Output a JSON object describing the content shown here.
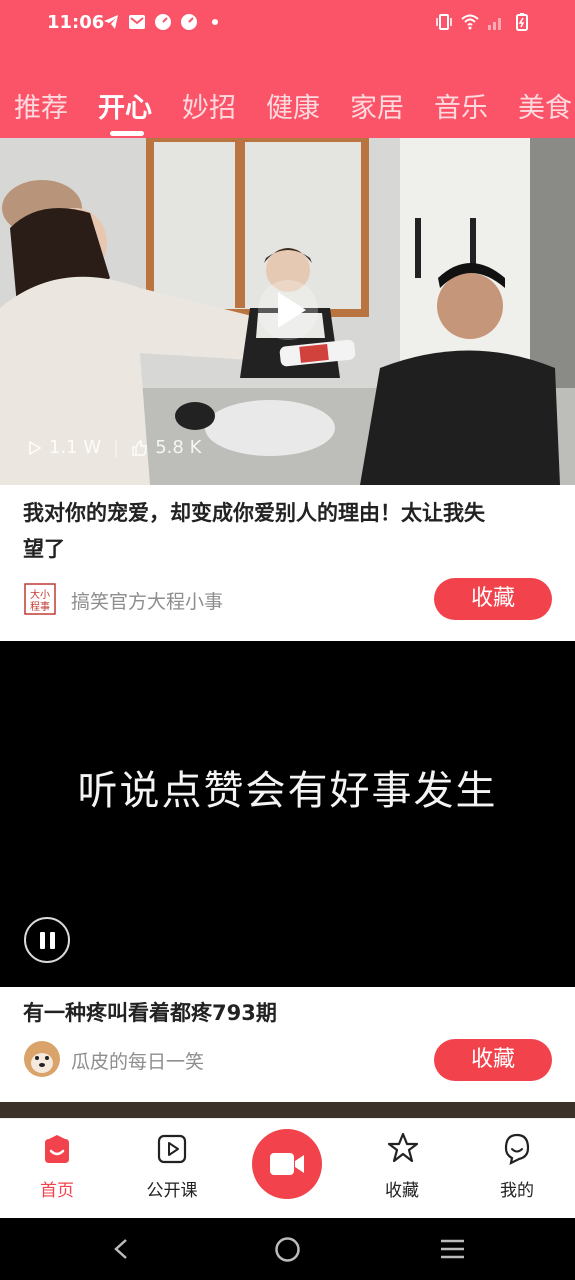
{
  "status_bar": {
    "time": "11:06"
  },
  "tabs": [
    {
      "label": "推荐",
      "active": false
    },
    {
      "label": "开心",
      "active": true
    },
    {
      "label": "妙招",
      "active": false
    },
    {
      "label": "健康",
      "active": false
    },
    {
      "label": "家居",
      "active": false
    },
    {
      "label": "音乐",
      "active": false
    },
    {
      "label": "美食",
      "active": false
    }
  ],
  "feed": [
    {
      "plays": "1.1 W",
      "likes": "5.8 K",
      "title_line1": "我对你的宠爱，却变成你爱别人的理由！太让我失",
      "title_line2": "望了",
      "author": "搞笑官方大程小事",
      "author_avatar_text": "大小程事",
      "fav_label": "收藏"
    },
    {
      "subtitle": "听说点赞会有好事发生",
      "title": "有一种疼叫看着都疼793期",
      "author": "瓜皮的每日一笑",
      "fav_label": "收藏"
    }
  ],
  "bottom_nav": {
    "home": "首页",
    "course": "公开课",
    "favorites": "收藏",
    "mine": "我的"
  },
  "colors": {
    "brand": "#fb5469",
    "accent": "#f2434d"
  }
}
